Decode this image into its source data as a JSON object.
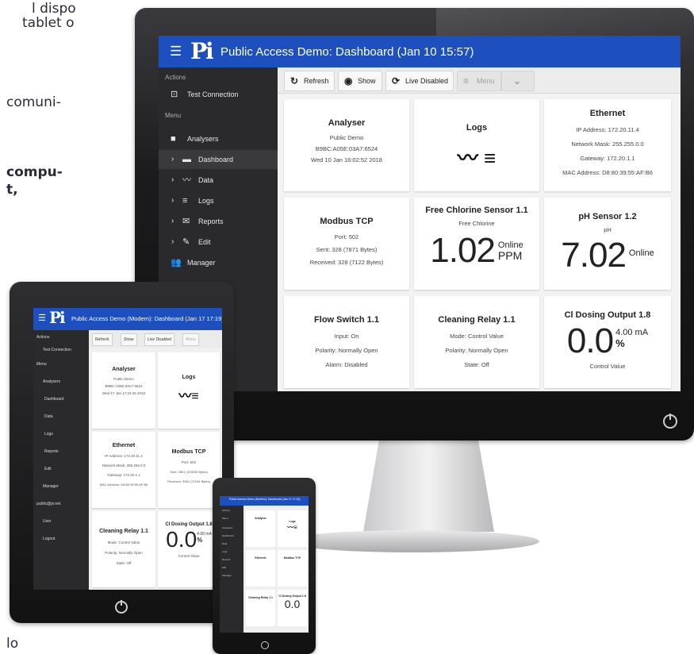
{
  "background_text": {
    "line1": "l dispo",
    "line2": "tablet o",
    "line3": "comuni-",
    "line4": "compu-",
    "line5": "t,",
    "line6": "lo"
  },
  "app": {
    "logo": "Pi",
    "title": "Public Access Demo: Dashboard (Jan 10 15:57)",
    "accent_color": "#1d4fbf"
  },
  "sidebar": {
    "actions_header": "Actions",
    "test_connection": "Test Connection",
    "menu_header": "Menu",
    "items": [
      {
        "label": "Analysers",
        "icon": "square-icon"
      },
      {
        "label": "Dashboard",
        "icon": "dashboard-icon"
      },
      {
        "label": "Data",
        "icon": "chart-line-icon"
      },
      {
        "label": "Logs",
        "icon": "list-icon"
      },
      {
        "label": "Reports",
        "icon": "mail-icon"
      },
      {
        "label": "Edit",
        "icon": "pencil-icon"
      },
      {
        "label": "Manager",
        "icon": "users-icon"
      }
    ]
  },
  "toolbar": {
    "refresh": "Refresh",
    "show": "Show",
    "live": "Live Disabled",
    "menu": "Menu"
  },
  "cards": {
    "analyser": {
      "title": "Analyser",
      "l1": "Public Demo",
      "l2": "B9BC:A05E:03A7:6524",
      "l3": "Wed 10 Jan 16:02:52 2018"
    },
    "logs": {
      "title": "Logs"
    },
    "ethernet": {
      "title": "Ethernet",
      "l1": "IP Address: 172.20.11.4",
      "l2": "Network Mask: 255.255.0.0",
      "l3": "Gateway: 172.20.1.1",
      "l4": "MAC Address: D8:80:39:55:AF:B6"
    },
    "modbus": {
      "title": "Modbus TCP",
      "l1": "Port: 502",
      "l2": "Sent: 328 (7871 Bytes)",
      "l3": "Received: 328 (7122 Bytes)"
    },
    "chlorine": {
      "title": "Free Chlorine Sensor 1.1",
      "sub": "Free Chlorine",
      "value": "1.02",
      "status": "Online",
      "unit": "PPM"
    },
    "ph": {
      "title": "pH Sensor 1.2",
      "sub": "pH",
      "value": "7.02",
      "status": "Online"
    },
    "flow": {
      "title": "Flow Switch 1.1",
      "l1": "Input: On",
      "l2": "Polarity: Normally Open",
      "l3": "Alarm: Disabled"
    },
    "relay": {
      "title": "Cleaning Relay 1.1",
      "l1": "Mode: Control Value",
      "l2": "Polarity: Normally Open",
      "l3": "State: Off"
    },
    "dosing": {
      "title": "Cl Dosing Output 1.8",
      "value": "0.0",
      "ma": "4.00 mA",
      "pct": "%",
      "sub": "Control Value"
    }
  },
  "tablet": {
    "title": "Public Access Demo (Modem): Dashboard (Jan 17 17:19)",
    "sidebar": [
      "Actions",
      "Test Connection",
      "Menu",
      "Analysers",
      "Dashboard",
      "Data",
      "Logs",
      "Reports",
      "Edit",
      "Manager",
      "public@pi.net",
      "User",
      "Logout"
    ],
    "toolbar": [
      "Refresh",
      "Show",
      "Live Disabled",
      "Menu"
    ],
    "analyser": {
      "title": "Analyser",
      "l1": "Public Demo",
      "l2": "B9BC:A05E:03A7:6524",
      "l3": "Wed 17 Jan 17:24:25 2018"
    },
    "logs": {
      "title": "Logs"
    },
    "ethernet": {
      "title": "Ethernet",
      "l1": "IP Address: 172.20.11.4",
      "l2": "Network Mask: 255.255.0.0",
      "l3": "Gateway: 172.20.1.1",
      "l4": "MAC Address: D8:80:39:55:AF:B6"
    },
    "modbus": {
      "title": "Modbus TCP",
      "l1": "Port: 502",
      "l2": "Sent: 3061 (103033 Bytes)",
      "l3": "Received: 3062 (72194 Bytes)"
    },
    "relay": {
      "title": "Cleaning Relay 1.1",
      "l1": "Mode: Control Value",
      "l2": "Polarity: Normally Open",
      "l3": "State: Off"
    },
    "dosing": {
      "title": "Cl Dosing Output 1.8",
      "value": "0.0",
      "ma": "4.00 mA",
      "pct": "%",
      "sub": "Control Value"
    }
  },
  "phone": {
    "title": "Public Access Demo (Modem): Dashboard (Jan 17 17:19)",
    "sidebar": [
      "Actions",
      "Menu",
      "Analysers",
      "Dashboard",
      "Data",
      "Logs",
      "Reports",
      "Edit",
      "Manager"
    ],
    "c1": "Analyser",
    "c2": "Logs",
    "c3": "Ethernet",
    "c4": "Modbus TCP",
    "c5": "Cleaning Relay 1.1",
    "c6": "Cl Dosing Output 1.8",
    "value": "0.0"
  }
}
